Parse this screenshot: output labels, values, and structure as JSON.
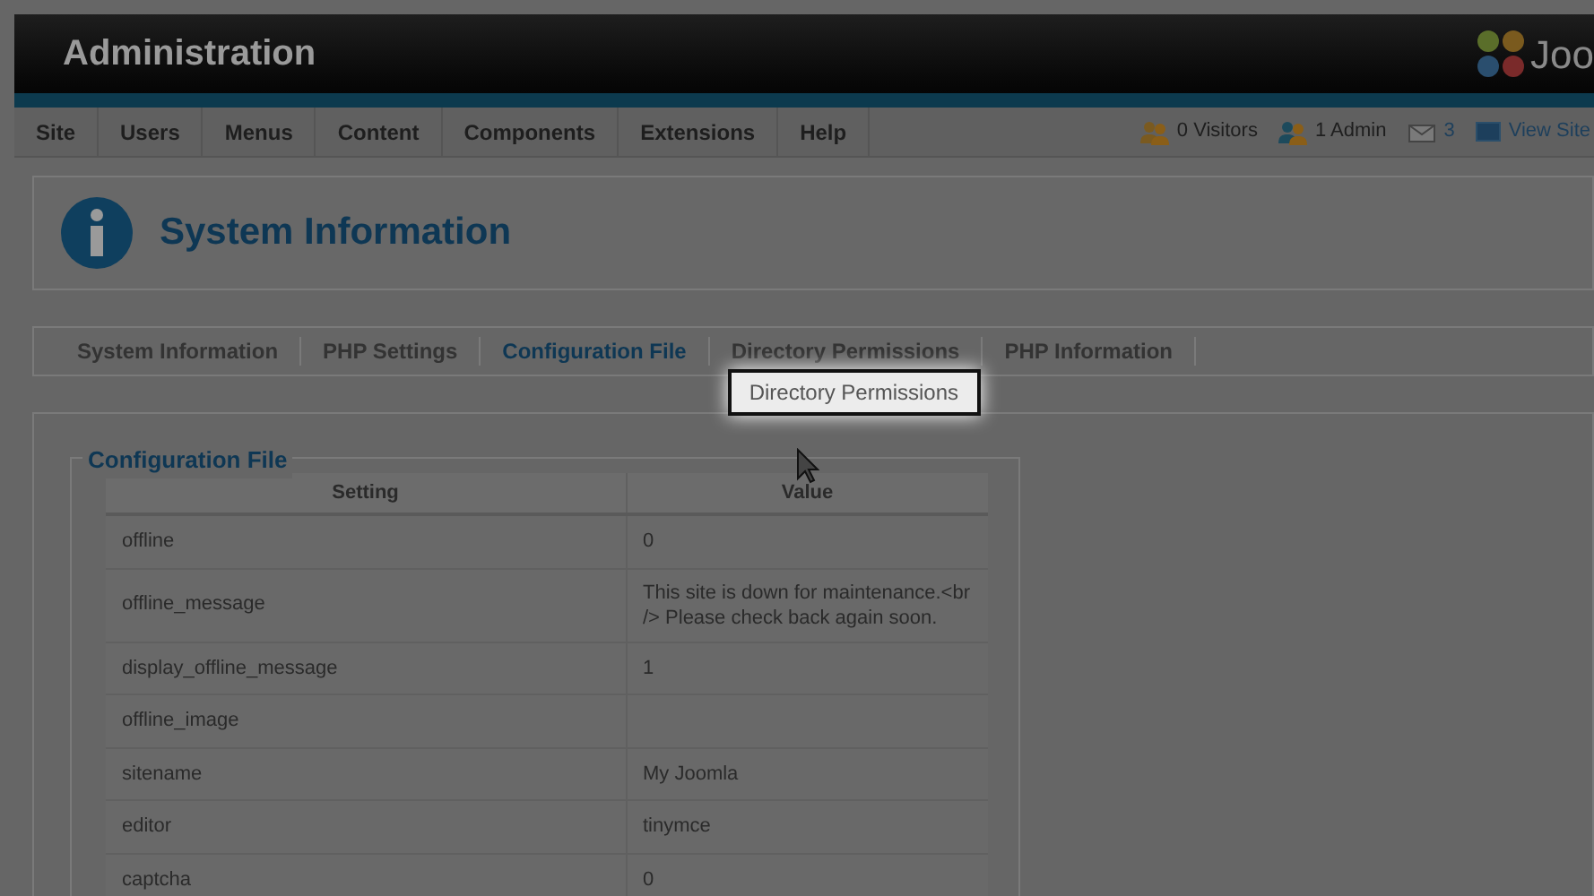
{
  "header": {
    "title": "Administration",
    "logo_text": "Joo"
  },
  "menu": [
    {
      "label": "Site"
    },
    {
      "label": "Users"
    },
    {
      "label": "Menus"
    },
    {
      "label": "Content"
    },
    {
      "label": "Components"
    },
    {
      "label": "Extensions"
    },
    {
      "label": "Help"
    }
  ],
  "status": [
    {
      "kind": "visitors",
      "label": "0 Visitors"
    },
    {
      "kind": "admin",
      "label": "1 Admin"
    },
    {
      "kind": "messages",
      "label": "3"
    },
    {
      "kind": "view",
      "label": "View Site"
    }
  ],
  "page_title": "System Information",
  "tabs": [
    {
      "label": "System Information",
      "selected": false
    },
    {
      "label": "PHP Settings",
      "selected": false
    },
    {
      "label": "Configuration File",
      "selected": true
    },
    {
      "label": "Directory Permissions",
      "selected": false,
      "highlighted": true
    },
    {
      "label": "PHP Information",
      "selected": false
    }
  ],
  "highlight_label": "Directory Permissions",
  "fieldset_title": "Configuration File",
  "table": {
    "columns": [
      "Setting",
      "Value"
    ],
    "rows": [
      [
        "offline",
        "0"
      ],
      [
        "offline_message",
        "This site is down for maintenance.<br /> Please check back again soon."
      ],
      [
        "display_offline_message",
        "1"
      ],
      [
        "offline_image",
        ""
      ],
      [
        "sitename",
        "My Joomla"
      ],
      [
        "editor",
        "tinymce"
      ],
      [
        "captcha",
        "0"
      ]
    ]
  }
}
